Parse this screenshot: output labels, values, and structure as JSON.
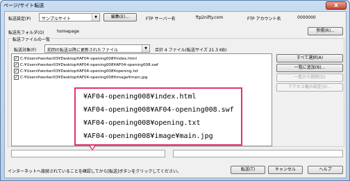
{
  "window": {
    "title": "ページ/サイト転送",
    "close_label": "x"
  },
  "settings": {
    "label": "転送設定(P)",
    "selected": "サンプルサイト",
    "edit_button": "編集(E)...",
    "ftp_server_label": "FTP サーバー名",
    "ftp_server_value": "ftp2nifty.com",
    "ftp_account_label": "FTP アカウント名",
    "ftp_account_value": "0000000"
  },
  "folder": {
    "label": "転送先フォルダ(O)",
    "value": "homepage",
    "browse_button": "参照(R)..."
  },
  "file_list": {
    "group_label": "転送ファイルの一覧",
    "target_label": "転送対象(F)",
    "target_selected": "前回の転送以降に更新されたファイル",
    "total": "合計 4 ファイル(転送サイズ 21.3 KB)",
    "files": [
      "C:¥Users¥worker03¥Desktop¥AF04-opening008¥index.html",
      "C:¥Users¥worker03¥Desktop¥AF04-opening008¥AF04-opening008.swf",
      "C:¥Users¥worker03¥Desktop¥AF04-opening008¥opening.txt",
      "C:¥Users¥worker03¥Desktop¥AF04-opening008¥image¥main.jpg"
    ]
  },
  "side_buttons": {
    "select_all": "すべて選択(A)",
    "add_batch": "一覧に追加(B)...",
    "remove": "一覧から削除(D)",
    "access_rights": "アクセス権の設定(S)..."
  },
  "zoom_callout": {
    "lines": [
      "¥AF04-opening008¥index.html",
      "¥AF04-opening008¥AF04-opening008.swf",
      "¥AF04-opening008¥opening.txt",
      "¥AF04-opening008¥image¥main.jpg"
    ]
  },
  "footer": {
    "message": "インターネットへ接続されていることを確認してから[転送]ボタンをクリックしてください。",
    "transfer_button": "転送(T)",
    "cancel_button": "キャンセル",
    "help_button": "ヘルプ"
  }
}
